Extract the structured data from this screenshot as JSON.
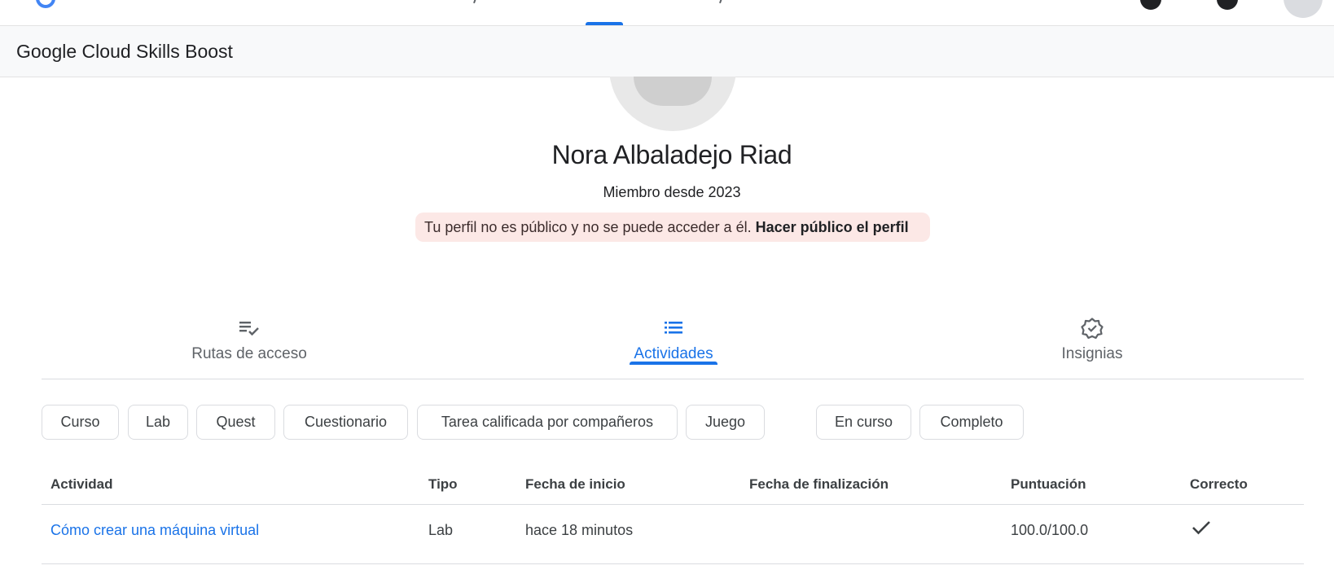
{
  "header": {
    "subheader_title": "Google Cloud Skills Boost"
  },
  "profile": {
    "name": "Nora Albaladejo Riad",
    "member_since": "Miembro desde 2023",
    "notice_text": "Tu perfil no es público y no se puede acceder a él.",
    "notice_action": "Hacer público el perfil"
  },
  "tabs": [
    {
      "label": "Rutas de acceso",
      "icon": "checklist-icon",
      "active": false
    },
    {
      "label": "Actividades",
      "icon": "list-icon",
      "active": true
    },
    {
      "label": "Insignias",
      "icon": "verified-badge-icon",
      "active": false
    }
  ],
  "filters": {
    "type_chips": [
      "Curso",
      "Lab",
      "Quest",
      "Cuestionario",
      "Tarea calificada por compañeros",
      "Juego"
    ],
    "status_chips": [
      "En curso",
      "Completo"
    ]
  },
  "table": {
    "columns": [
      "Actividad",
      "Tipo",
      "Fecha de inicio",
      "Fecha de finalización",
      "Puntuación",
      "Correcto"
    ],
    "rows": [
      {
        "activity": "Cómo crear una máquina virtual",
        "type": "Lab",
        "start": "hace 18 minutos",
        "end": "",
        "score": "100.0/100.0",
        "correct_icon": "check-icon"
      }
    ]
  },
  "colors": {
    "accent": "#1a73e8",
    "notice_bg": "#fce8e6",
    "subheader_bg": "#f8f9fa"
  }
}
